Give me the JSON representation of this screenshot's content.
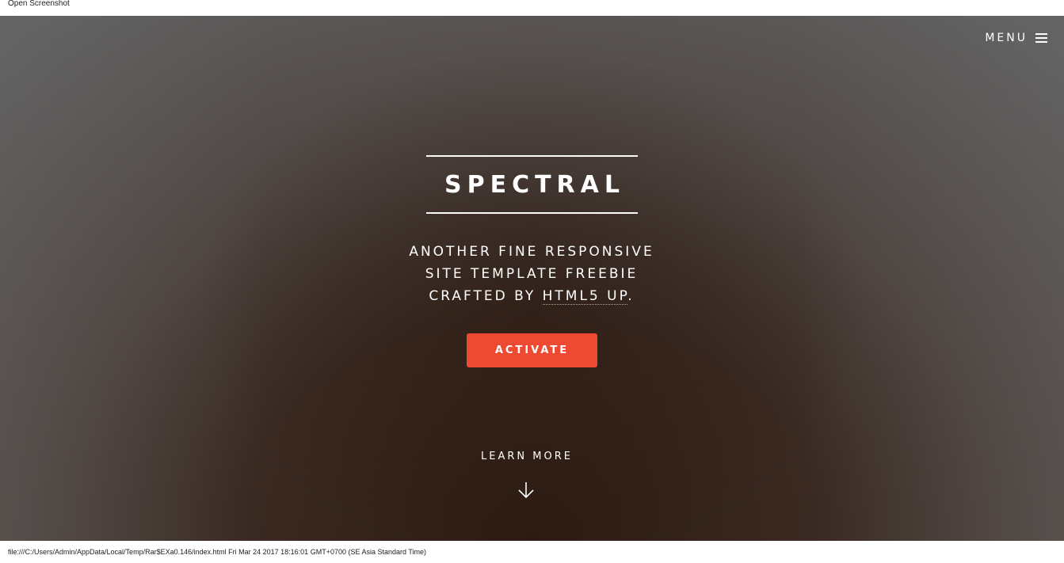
{
  "browser": {
    "caption": "Open Screenshot",
    "status_text": "file:///C:/Users/Admin/AppData/Local/Temp/Rar$EXa0.146/index.html Fri Mar 24 2017 18:16:01 GMT+0700 (SE Asia Standard Time)"
  },
  "header": {
    "menu_label": "MENU"
  },
  "hero": {
    "title": "SPECTRAL",
    "subtitle_line1": "ANOTHER FINE RESPONSIVE",
    "subtitle_line2": "SITE TEMPLATE FREEBIE",
    "subtitle_line3_prefix": "CRAFTED BY ",
    "subtitle_link": "HTML5 UP",
    "subtitle_line3_suffix": ".",
    "button_label": "ACTIVATE"
  },
  "footer": {
    "learn_more_label": "LEARN MORE"
  },
  "icons": {
    "menu": "hamburger-icon",
    "scroll": "arrow-down-icon"
  },
  "colors": {
    "accent": "#ed4933"
  }
}
